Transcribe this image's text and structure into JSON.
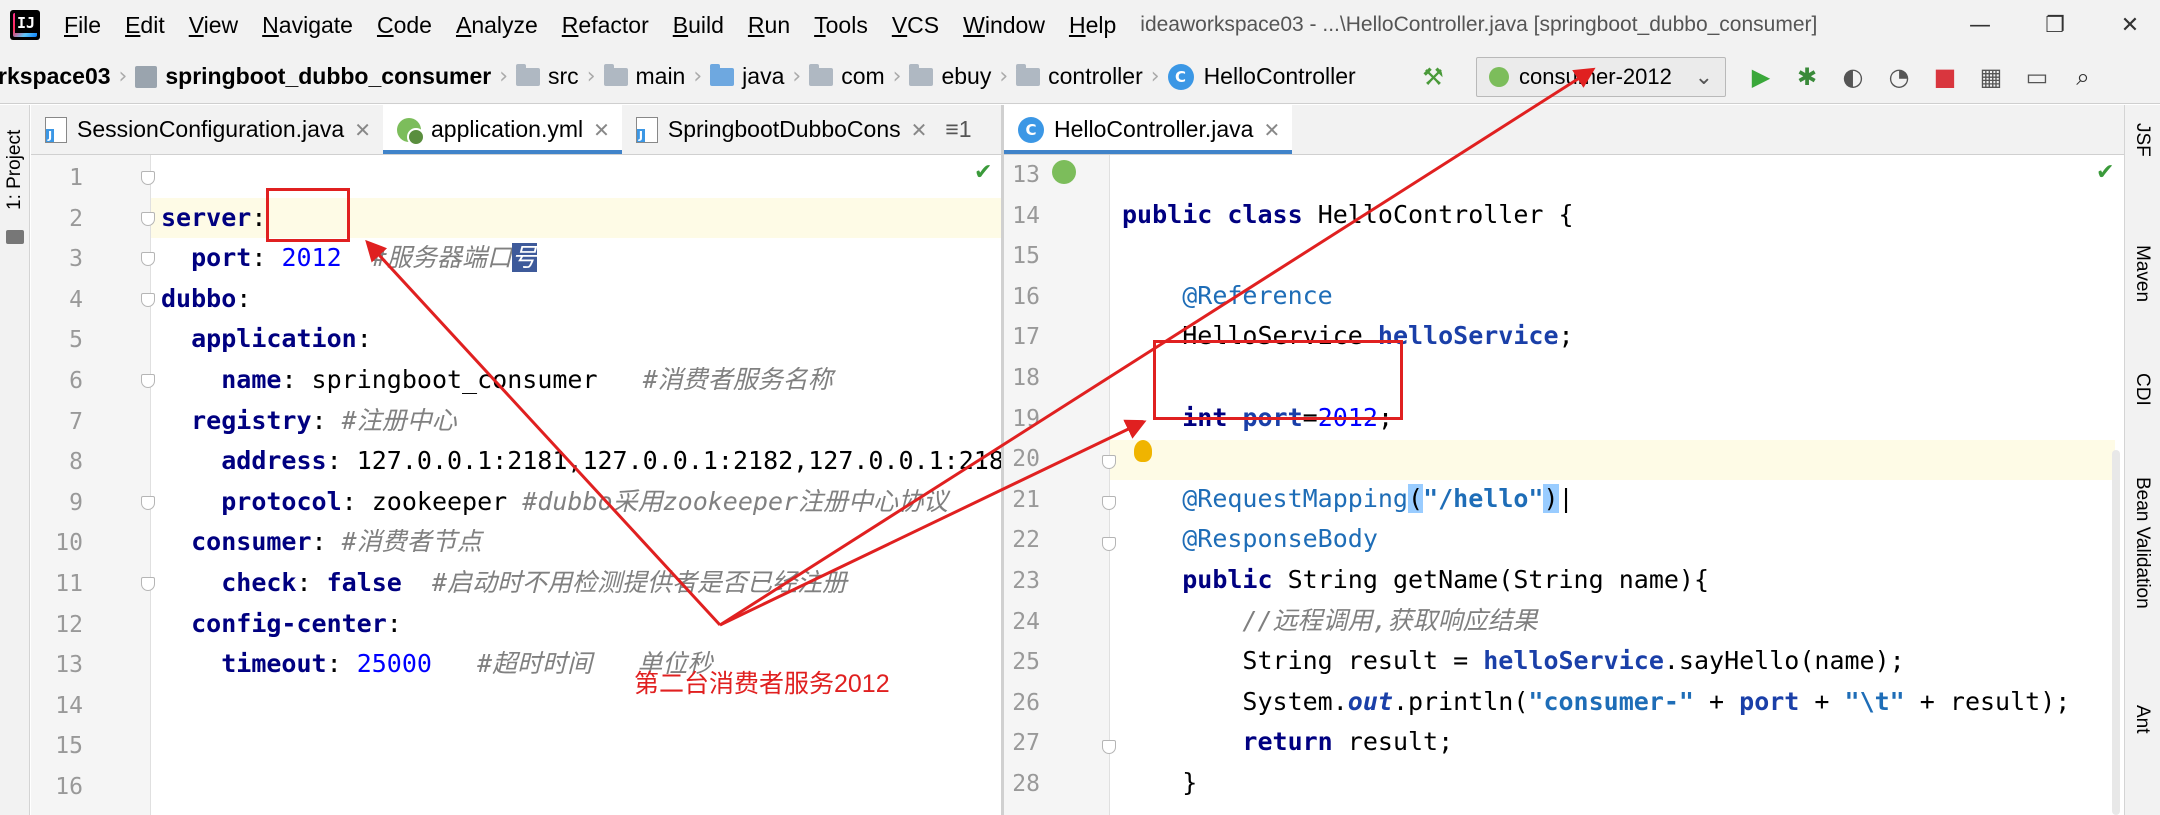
{
  "menubar": {
    "items": [
      "File",
      "Edit",
      "View",
      "Navigate",
      "Code",
      "Analyze",
      "Refactor",
      "Build",
      "Run",
      "Tools",
      "VCS",
      "Window",
      "Help"
    ],
    "window_title": "ideaworkspace03 - ...\\HelloController.java [springboot_dubbo_consumer]"
  },
  "navbar": {
    "workspace": "rkspace03",
    "module": "springboot_dubbo_consumer",
    "crumbs": [
      "src",
      "main",
      "java",
      "com",
      "ebuy",
      "controller"
    ],
    "class_name": "HelloController",
    "run_config": "consumer-2012"
  },
  "left_strip": {
    "project_tab": "1: Project"
  },
  "right_strip": {
    "tabs": [
      "JSF",
      "Maven",
      "CDI",
      "Bean Validation",
      "Ant"
    ]
  },
  "left_editor": {
    "tabs": [
      {
        "label": "SessionConfiguration.java",
        "icon": "java-file-icon"
      },
      {
        "label": "application.yml",
        "icon": "yml-file-icon",
        "active": true
      },
      {
        "label": "SpringbootDubboCons",
        "icon": "java-file-icon"
      }
    ],
    "tab_overflow": "≡1",
    "line_numbers": [
      "1",
      "2",
      "3",
      "4",
      "5",
      "6",
      "7",
      "8",
      "9",
      "10",
      "11",
      "12",
      "13",
      "14",
      "15",
      "16"
    ],
    "lines": {
      "l1_key": "server",
      "l2_key": "port",
      "l2_val": "2012",
      "l2_cmt": "#服务器端口",
      "l2_sel": "号",
      "l3_key": "dubbo",
      "l4_key": "application",
      "l5_key": "name",
      "l5_val": "springboot_consumer",
      "l5_cmt": "#消费者服务名称",
      "l6_key": "registry",
      "l6_cmt": "#注册中心",
      "l7_key": "address",
      "l7_val": "127.0.0.1:2181,127.0.0.1:2182,127.0.0.1:218",
      "l8_key": "protocol",
      "l8_val": "zookeeper",
      "l8_cmt": "#dubbo采用zookeeper注册中心协议",
      "l9_key": "consumer",
      "l9_cmt": "#消费者节点",
      "l10_key": "check",
      "l10_val": "false",
      "l10_cmt": "#启动时不用检测提供者是否已经注册",
      "l11_key": "config-center",
      "l12_key": "timeout",
      "l12_val": "25000",
      "l12_cmt": "#超时时间   单位秒"
    }
  },
  "right_editor": {
    "tabs": [
      {
        "label": "HelloController.java",
        "icon": "class-icon",
        "active": true
      }
    ],
    "line_numbers": [
      "13",
      "14",
      "15",
      "16",
      "17",
      "18",
      "19",
      "20",
      "21",
      "22",
      "23",
      "24",
      "25",
      "26",
      "27",
      "28"
    ],
    "lines": {
      "l13_kw1": "public",
      "l13_kw2": "class",
      "l13_rest": " HelloController {",
      "l15_ann": "@Reference",
      "l16_type": "HelloService ",
      "l16_field": "helloService",
      "l16_end": ";",
      "l18_kw": "int",
      "l18_field": "port",
      "l18_eq": "=",
      "l18_num": "2012",
      "l18_end": ";",
      "l20_ann": "@RequestMapping",
      "l20_p1": "(",
      "l20_str": "\"/hello\"",
      "l20_p2": ")",
      "l21_ann": "@ResponseBody",
      "l22_kw": "public",
      "l22_rest": " String getName(String name){",
      "l23_cmt": "//远程调用,获取响应结果",
      "l24_a": "String result = ",
      "l24_field": "helloService",
      "l24_b": ".sayHello(name);",
      "l25_a": "System.",
      "l25_static": "out",
      "l25_b": ".println(",
      "l25_s1": "\"consumer-\"",
      "l25_c": " + ",
      "l25_field": "port",
      "l25_d": " + ",
      "l25_s2": "\"\\t\"",
      "l25_e": " + result);",
      "l26_kw": "return",
      "l26_rest": " result;",
      "l27": "}"
    }
  },
  "annotation": {
    "label": "第二台消费者服务2012"
  },
  "colors": {
    "annotation_red": "#e02020",
    "keyword_navy": "#000080",
    "tab_accent": "#4083c9"
  }
}
